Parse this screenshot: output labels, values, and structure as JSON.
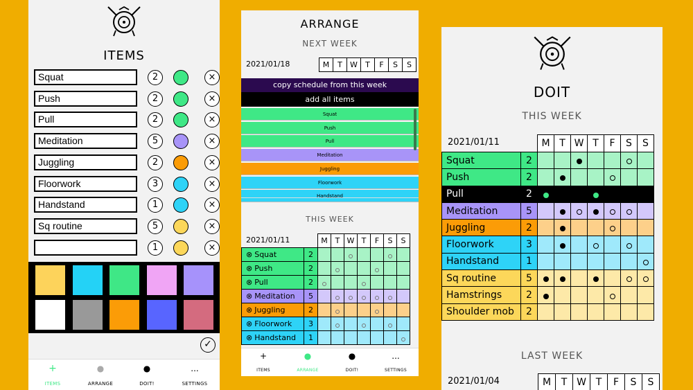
{
  "colors": {
    "green": "#3fe886",
    "purple": "#a894f8",
    "orange": "#fb9c07",
    "cyan": "#2ed3f7",
    "yellow": "#fcd75a",
    "background": "#f0ad00"
  },
  "items_screen": {
    "title": "ITEMS",
    "logo": "shield-helmet-logo",
    "items": [
      {
        "name": "Squat",
        "count": "2",
        "color": "#3fe886"
      },
      {
        "name": "Push",
        "count": "2",
        "color": "#3fe886"
      },
      {
        "name": "Pull",
        "count": "2",
        "color": "#3fe886"
      },
      {
        "name": "Meditation",
        "count": "5",
        "color": "#a894f8"
      },
      {
        "name": "Juggling",
        "count": "2",
        "color": "#fb9c07"
      },
      {
        "name": "Floorwork",
        "count": "3",
        "color": "#2ed3f7"
      },
      {
        "name": "Handstand",
        "count": "1",
        "color": "#2ed3f7"
      },
      {
        "name": "Sq routine",
        "count": "5",
        "color": "#fcd75a"
      },
      {
        "name": "",
        "count": "1",
        "color": "#fcd75a"
      }
    ],
    "delete_glyph": "×",
    "palette": [
      "#fdd35b",
      "#24d2f6",
      "#3fe786",
      "#f0a5f5",
      "#a692fb",
      "#ffffff",
      "#999999",
      "#fb9c07",
      "#5865ff",
      "#d46b7f"
    ],
    "confirm_glyph": "✓"
  },
  "tabs": [
    {
      "label": "ITEMS",
      "icon": "+",
      "icon_name": "plus-icon"
    },
    {
      "label": "ARRANGE",
      "icon": "●",
      "icon_name": "gray-dot-icon"
    },
    {
      "label": "DOIT!",
      "icon": "●",
      "icon_name": "black-dot-icon"
    },
    {
      "label": "SETTINGS",
      "icon": "...",
      "icon_name": "ellipsis-icon"
    }
  ],
  "arrange_screen": {
    "title": "ARRANGE",
    "next_week": {
      "label": "NEXT WEEK",
      "date": "2021/01/18",
      "days": [
        "M",
        "T",
        "W",
        "T",
        "F",
        "S",
        "S"
      ],
      "copy_button": "copy schedule from this week",
      "add_all_button": "add all items",
      "items": [
        {
          "name": "Squat",
          "color": "#3fe886"
        },
        {
          "name": "Push",
          "color": "#3fe886"
        },
        {
          "name": "Pull",
          "color": "#3fe886"
        },
        {
          "name": "Meditation",
          "color": "#a894f8"
        },
        {
          "name": "Juggling",
          "color": "#fb9c07"
        },
        {
          "name": "Floorwork",
          "color": "#2ed3f7"
        },
        {
          "name": "Handstand",
          "color": "#2ed3f7"
        }
      ]
    },
    "this_week": {
      "label": "THIS WEEK",
      "date": "2021/01/11",
      "days": [
        "M",
        "T",
        "W",
        "T",
        "F",
        "S",
        "S"
      ],
      "rows": [
        {
          "name": "Squat",
          "count": "2",
          "color": "#3fe886",
          "light": "#a8f3c6",
          "marks": [
            0,
            0,
            1,
            0,
            0,
            1,
            0
          ]
        },
        {
          "name": "Push",
          "count": "2",
          "color": "#3fe886",
          "light": "#a8f3c6",
          "marks": [
            0,
            1,
            0,
            0,
            1,
            0,
            0
          ]
        },
        {
          "name": "Pull",
          "count": "2",
          "color": "#3fe886",
          "light": "#a8f3c6",
          "marks": [
            1,
            0,
            0,
            1,
            0,
            0,
            0
          ]
        },
        {
          "name": "Meditation",
          "count": "5",
          "color": "#a894f8",
          "light": "#d3c8fb",
          "marks": [
            0,
            1,
            1,
            1,
            1,
            1,
            0
          ]
        },
        {
          "name": "Juggling",
          "count": "2",
          "color": "#fb9c07",
          "light": "#fdd08a",
          "marks": [
            0,
            1,
            0,
            0,
            1,
            0,
            0
          ]
        },
        {
          "name": "Floorwork",
          "count": "3",
          "color": "#2ed3f7",
          "light": "#9fe9fb",
          "marks": [
            0,
            1,
            0,
            1,
            0,
            1,
            0
          ]
        },
        {
          "name": "Handstand",
          "count": "1",
          "color": "#2ed3f7",
          "light": "#9fe9fb",
          "marks": [
            0,
            0,
            0,
            0,
            0,
            0,
            1
          ]
        }
      ]
    }
  },
  "doit_screen": {
    "title": "DOIT",
    "logo": "shield-helmet-logo",
    "this_week": {
      "label": "THIS WEEK",
      "date": "2021/01/11",
      "days": [
        "M",
        "T",
        "W",
        "T",
        "F",
        "S",
        "S"
      ],
      "rows": [
        {
          "name": "Squat",
          "count": "2",
          "color": "#3fe886",
          "light": "#a8f3c6",
          "marks": [
            0,
            0,
            2,
            0,
            0,
            1,
            0
          ]
        },
        {
          "name": "Push",
          "count": "2",
          "color": "#3fe886",
          "light": "#a8f3c6",
          "marks": [
            0,
            2,
            0,
            0,
            1,
            0,
            0
          ]
        },
        {
          "name": "Pull",
          "count": "2",
          "color": "#000000",
          "light": "#000000",
          "text": "#ffffff",
          "marks": [
            3,
            0,
            0,
            3,
            0,
            0,
            0
          ]
        },
        {
          "name": "Meditation",
          "count": "5",
          "color": "#a894f8",
          "light": "#d3c8fb",
          "marks": [
            0,
            2,
            1,
            2,
            1,
            1,
            0
          ]
        },
        {
          "name": "Juggling",
          "count": "2",
          "color": "#fb9c07",
          "light": "#fdd08a",
          "marks": [
            0,
            2,
            0,
            0,
            1,
            0,
            0
          ]
        },
        {
          "name": "Floorwork",
          "count": "3",
          "color": "#2ed3f7",
          "light": "#9fe9fb",
          "marks": [
            0,
            2,
            0,
            1,
            0,
            1,
            0
          ]
        },
        {
          "name": "Handstand",
          "count": "1",
          "color": "#2ed3f7",
          "light": "#9fe9fb",
          "marks": [
            0,
            0,
            0,
            0,
            0,
            0,
            1
          ]
        },
        {
          "name": "Sq routine",
          "count": "5",
          "color": "#fcd75a",
          "light": "#fde9a8",
          "marks": [
            2,
            2,
            0,
            2,
            0,
            1,
            1
          ]
        },
        {
          "name": "Hamstrings",
          "count": "2",
          "color": "#fcd75a",
          "light": "#fde9a8",
          "marks": [
            2,
            0,
            0,
            0,
            1,
            0,
            0
          ]
        },
        {
          "name": "Shoulder mob",
          "count": "2",
          "color": "#fcd75a",
          "light": "#fde9a8",
          "marks": [
            0,
            0,
            0,
            0,
            0,
            0,
            0
          ]
        }
      ]
    },
    "last_week": {
      "label": "LAST WEEK",
      "date": "2021/01/04",
      "days": [
        "M",
        "T",
        "W",
        "T",
        "F",
        "S",
        "S"
      ]
    }
  }
}
